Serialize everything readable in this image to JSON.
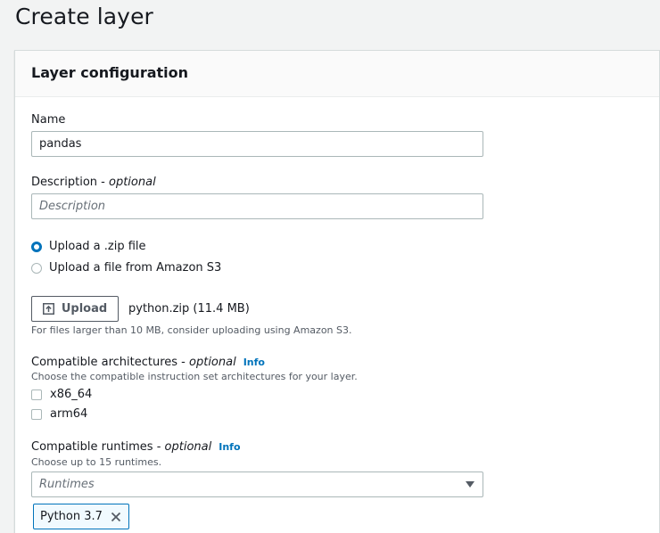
{
  "page": {
    "title": "Create layer"
  },
  "panel": {
    "title": "Layer configuration"
  },
  "name": {
    "label": "Name",
    "value": "pandas"
  },
  "description": {
    "label": "Description - ",
    "optional": "optional",
    "value": "",
    "placeholder": "Description"
  },
  "upload_source": {
    "options": [
      {
        "label": "Upload a .zip file",
        "checked": true
      },
      {
        "label": "Upload a file from Amazon S3",
        "checked": false
      }
    ]
  },
  "upload": {
    "button_label": "Upload",
    "file": "python.zip (11.4 MB)",
    "hint": "For files larger than 10 MB, consider uploading using Amazon S3."
  },
  "architectures": {
    "label": "Compatible architectures - ",
    "optional": "optional",
    "info": "Info",
    "hint": "Choose the compatible instruction set architectures for your layer.",
    "options": [
      {
        "label": "x86_64",
        "checked": false
      },
      {
        "label": "arm64",
        "checked": false
      }
    ]
  },
  "runtimes": {
    "label": "Compatible runtimes - ",
    "optional": "optional",
    "info": "Info",
    "hint": "Choose up to 15 runtimes.",
    "placeholder": "Runtimes",
    "selected": [
      {
        "label": "Python 3.7"
      }
    ]
  },
  "colors": {
    "accent": "#0073bb",
    "text": "#16191f",
    "muted": "#545b64",
    "border": "#aab7b8",
    "background": "#f2f3f3"
  },
  "icons": {
    "upload": "upload-icon",
    "dropdown": "caret-down-icon",
    "remove_token": "close-icon"
  }
}
